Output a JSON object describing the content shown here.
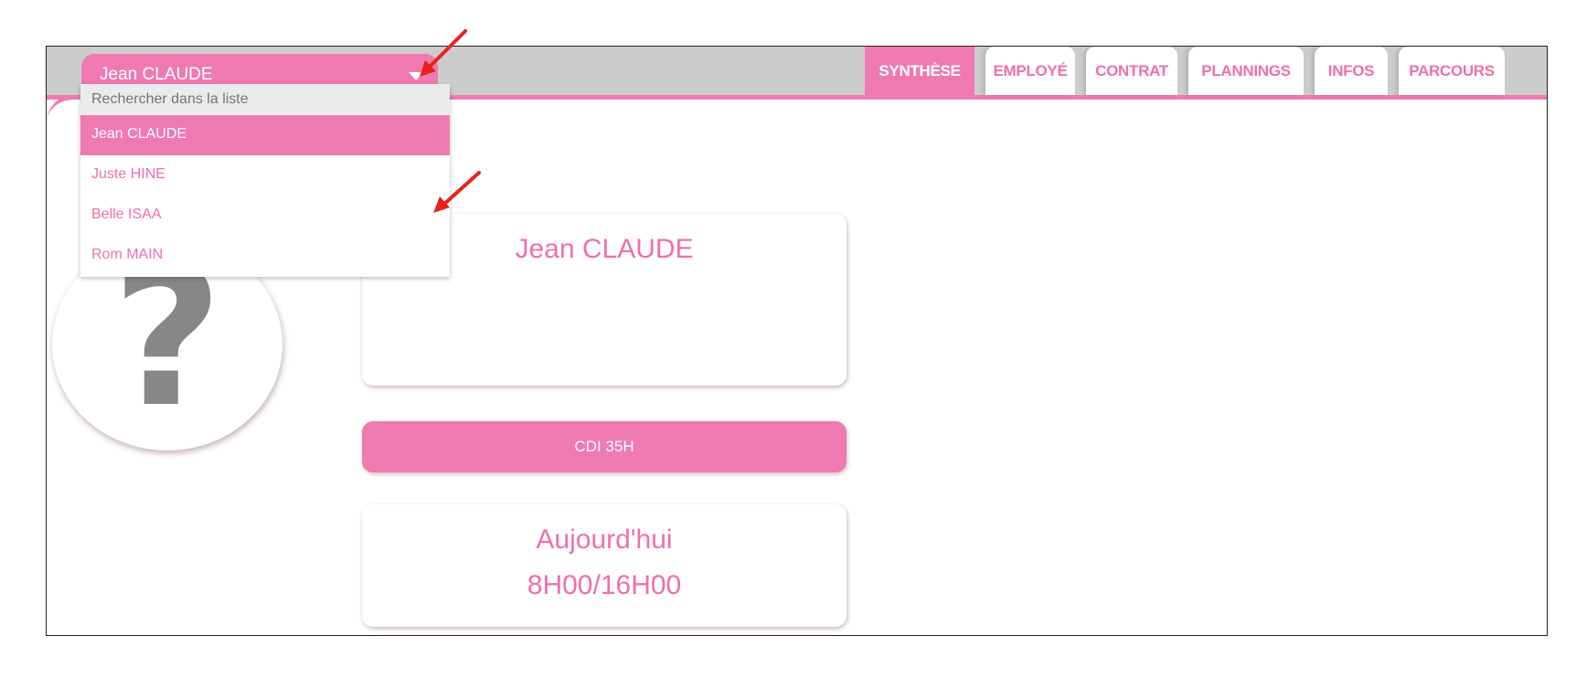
{
  "employee_select": {
    "selected": "Jean CLAUDE",
    "search_placeholder": "Rechercher dans la liste",
    "options": [
      "Jean CLAUDE",
      "Juste HINE",
      "Belle ISAA",
      "Rom MAIN"
    ]
  },
  "tabs": [
    {
      "label": "SYNTHÈSE",
      "active": true
    },
    {
      "label": "EMPLOYÉ",
      "active": false
    },
    {
      "label": "CONTRAT",
      "active": false
    },
    {
      "label": "PLANNINGS",
      "active": false
    },
    {
      "label": "INFOS",
      "active": false
    },
    {
      "label": "PARCOURS",
      "active": false
    }
  ],
  "summary": {
    "name": "Jean CLAUDE",
    "contract": "CDI 35H",
    "today_label": "Aujourd'hui",
    "today_hours": "8H00/16H00"
  },
  "colors": {
    "accent": "#ef7ab1",
    "header_bg": "#cccccc",
    "avatar_icon": "#878787",
    "annotation_arrow": "#e8231c"
  },
  "icons": {
    "avatar": "question-mark-icon",
    "select_toggle": "caret-down-icon",
    "annotation": "red-arrow-icon"
  }
}
